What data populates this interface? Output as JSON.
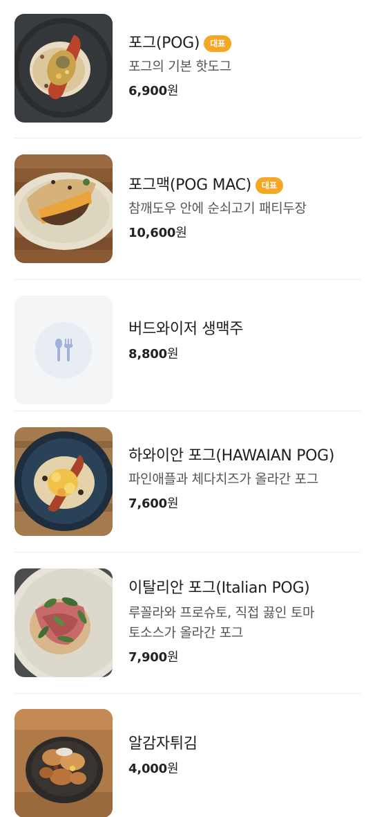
{
  "menu": {
    "items": [
      {
        "name": "포그(POG)",
        "badge": "대표",
        "desc": "포그의 기본 핫도그",
        "price": "6,900",
        "unit": "원",
        "image": "photo-hotdog"
      },
      {
        "name": "포그맥(POG MAC)",
        "badge": "대표",
        "desc": "참깨도우 안에 순쇠고기 패티두장",
        "price": "10,600",
        "unit": "원",
        "image": "photo-burger-pita"
      },
      {
        "name": "버드와이저 생맥주",
        "price": "8,800",
        "unit": "원",
        "image": "utensils-icon"
      },
      {
        "name": "하와이안 포그(HAWAIAN POG)",
        "desc": "파인애플과 체다치즈가 올라간 포그",
        "price": "7,600",
        "unit": "원",
        "image": "photo-hawaiian-hotdog"
      },
      {
        "name": "이탈리안 포그(Italian POG)",
        "desc_lines": [
          "루꼴라와 프로슈토, 직접 끓인 토마",
          "토소스가 올라간 포그"
        ],
        "price": "7,900",
        "unit": "원",
        "image": "photo-italian-hotdog"
      },
      {
        "name": "알감자튀김",
        "price": "4,000",
        "unit": "원",
        "image": "photo-fried-potatoes"
      }
    ]
  },
  "colors": {
    "badge": "#f5a623",
    "placeholder_bg": "#f4f5f7",
    "placeholder_icon": "#9fb2dc"
  }
}
